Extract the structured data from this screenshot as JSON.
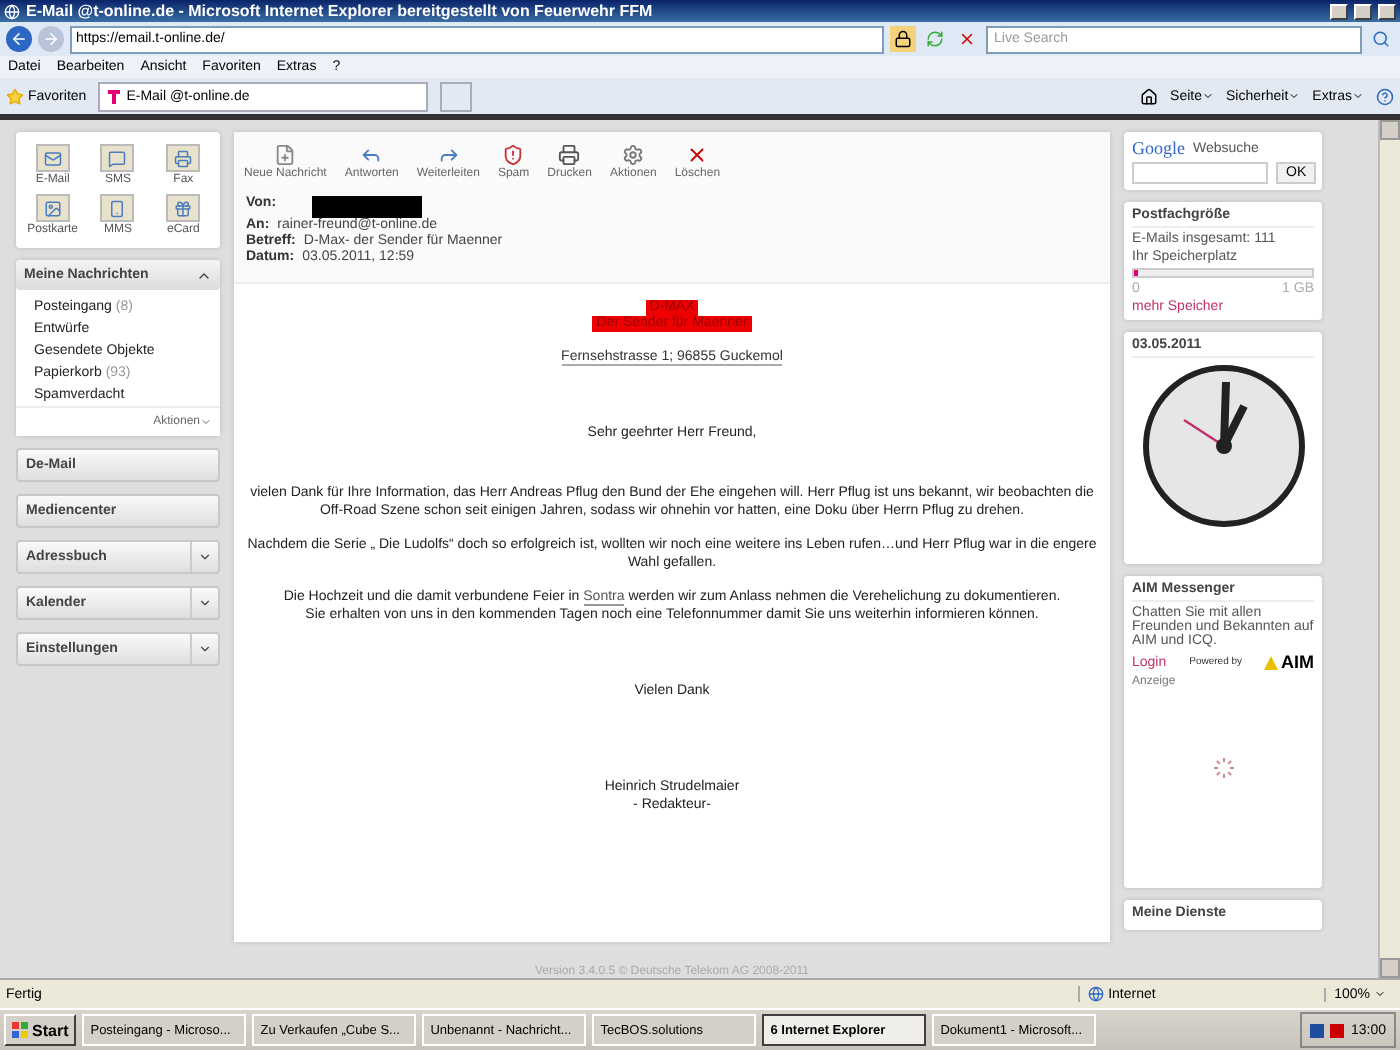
{
  "window": {
    "title": "E-Mail @t-online.de - Microsoft Internet Explorer bereitgestellt von Feuerwehr FFM"
  },
  "browser": {
    "url": "https://email.t-online.de/",
    "search_placeholder": "Live Search",
    "menu": [
      "Datei",
      "Bearbeiten",
      "Ansicht",
      "Favoriten",
      "Extras",
      "?"
    ],
    "favorites": "Favoriten",
    "tab": "E-Mail @t-online.de",
    "tools": [
      "Seite",
      "Sicherheit",
      "Extras"
    ]
  },
  "sidebar": {
    "apps": [
      {
        "label": "E-Mail",
        "kind": "mail"
      },
      {
        "label": "SMS",
        "kind": "sms"
      },
      {
        "label": "Fax",
        "kind": "fax"
      },
      {
        "label": "Postkarte",
        "kind": "postcard"
      },
      {
        "label": "MMS",
        "kind": "mms"
      },
      {
        "label": "eCard",
        "kind": "ecard"
      }
    ],
    "folders_panel": {
      "title": "Meine Nachrichten",
      "expanded": true,
      "items": [
        {
          "name": "Posteingang",
          "count": "(8)"
        },
        {
          "name": "Entwürfe"
        },
        {
          "name": "Gesendete Objekte"
        },
        {
          "name": "Papierkorb",
          "count": "(93)"
        },
        {
          "name": "Spamverdacht"
        }
      ],
      "actions": "Aktionen"
    },
    "sections": [
      {
        "label": "De-Mail",
        "has_menu": false
      },
      {
        "label": "Mediencenter",
        "has_menu": false
      },
      {
        "label": "Adressbuch",
        "has_menu": true
      },
      {
        "label": "Kalender",
        "has_menu": true
      },
      {
        "label": "Einstellungen",
        "has_menu": true
      }
    ]
  },
  "toolbar": [
    {
      "label": "Neue Nachricht",
      "kind": "new"
    },
    {
      "label": "Antworten",
      "kind": "reply"
    },
    {
      "label": "Weiterleiten",
      "kind": "forward"
    },
    {
      "label": "Spam",
      "kind": "spam"
    },
    {
      "label": "Drucken",
      "kind": "print"
    },
    {
      "label": "Aktionen",
      "kind": "actions"
    },
    {
      "label": "Löschen",
      "kind": "delete"
    }
  ],
  "header": {
    "fields": [
      {
        "label": "Von:",
        "redacted": true
      },
      {
        "label": "An:",
        "value": "rainer-freund@t-online.de",
        "redacted": false
      },
      {
        "label": "Betreff:",
        "value": "D-Max- der Sender für Maenner",
        "redacted": false
      },
      {
        "label": "Datum:",
        "value": "03.05.2011, 12:59",
        "redacted": false
      }
    ]
  },
  "message": {
    "banner": [
      "D-MAX",
      "Der Sender für Maenner"
    ],
    "address": "Fernsehstrasse 1; 96855 Guckemol",
    "greeting": "Sehr geehrter Herr Freund,",
    "paragraphs": [
      {
        "text": "vielen Dank für Ihre Information, das Herr Andreas Pflug den Bund der Ehe eingehen will. Herr Pflug ist uns bekannt, wir beobachten die Off-Road Szene schon seit einigen Jahren, sodass wir ohnehin vor hatten,  eine Doku über Herrn Pflug zu drehen."
      },
      {
        "text": "Nachdem die Serie „ Die Ludolfs“ doch so erfolgreich ist, wollten wir noch eine weitere ins Leben rufen…und Herr Pflug war in die engere Wahl gefallen."
      },
      {
        "text": "Die Hochzeit und die damit verbundene Feier in ",
        "link": "Sontra",
        "after": " werden wir zum Anlass nehmen die Verehelichung zu dokumentieren.",
        "line2": "Sie erhalten von uns in den kommenden Tagen noch eine Telefonnummer damit Sie uns weiterhin informieren können."
      }
    ],
    "closing": "Vielen Dank",
    "signature": [
      "Heinrich Strudelmaier",
      "- Redakteur-"
    ]
  },
  "footer": "Version 3.4.0.5 © Deutsche Telekom AG 2008-2011",
  "right": {
    "google": {
      "logo": "Google",
      "label": "Websuche",
      "button": "OK"
    },
    "mailbox": {
      "title": "Postfachgröße",
      "total": "E-Mails insgesamt: 111",
      "storage_label": "Ihr Speicherplatz",
      "level": 0.02,
      "min": "0",
      "max": "1 GB",
      "link": "mehr Speicher"
    },
    "clock": {
      "date": "03.05.2011"
    },
    "aim": {
      "title": "AIM Messenger",
      "text": "Chatten Sie mit allen Freunden und Bekannten auf AIM und ICQ.",
      "login": "Login",
      "powered": "Powered by",
      "brand": "AIM",
      "ad": "Anzeige"
    },
    "services": "Meine Dienste"
  },
  "status": {
    "text": "Fertig",
    "zone": "Internet",
    "zoom": "100%"
  },
  "taskbar": {
    "start": "Start",
    "tasks": [
      {
        "label": "Posteingang - Microso...",
        "selected": false
      },
      {
        "label": "Zu Verkaufen „Cube S...",
        "selected": false
      },
      {
        "label": "Unbenannt - Nachricht...",
        "selected": false
      },
      {
        "label": "TecBOS.solutions",
        "selected": false
      },
      {
        "label": "6 Internet Explorer",
        "selected": true
      },
      {
        "label": "Dokument1 - Microsoft...",
        "selected": false
      }
    ],
    "time": "13:00"
  }
}
